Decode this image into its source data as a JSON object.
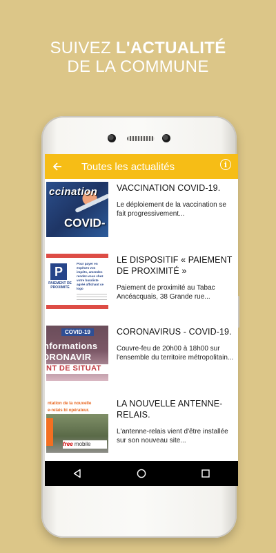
{
  "headline": {
    "line1_prefix": "SUIVEZ ",
    "line1_bold": "L'ACTUALITÉ",
    "line2": "DE LA COMMUNE"
  },
  "appbar": {
    "title": "Toutes les actualités",
    "back_icon": "arrow-left-icon",
    "info_icon": "info-icon",
    "color": "#f6bd16"
  },
  "news": [
    {
      "title": "VACCINATION COVID-19.",
      "description": "Le déploiement de la vaccination se fait progressivement...",
      "thumb_text": [
        "ccination",
        "COVID-"
      ]
    },
    {
      "title": "LE DISPOSITIF « PAIEMENT DE PROXIMITÉ »",
      "description": "Paiement de proximité au Tabac Ancéacquais, 38 Grande rue...",
      "thumb_text": [
        "P",
        "PAIEMENT DE PROXIMITÉ",
        "Pour payer en espèces vos impôts, amendes rendez-vous chez votre buraliste agréé affichant ce logo"
      ]
    },
    {
      "title": "CORONAVIRUS - COVID-19.",
      "description": "Couvre-feu de 20h00 à 18h00 sur l'ensemble du territoire métropolitain...",
      "thumb_text": [
        "COVID-19",
        "nformations",
        "ORONAVIR",
        "NT DE SITUAT"
      ]
    },
    {
      "title": "LA NOUVELLE ANTENNE-RELAIS.",
      "description": "L'antenne-relais vient d'être installée sur son nouveau site...",
      "thumb_text": [
        "ntation de la nouvelle",
        "e-relais bi opérateur.",
        "free",
        "mobile"
      ]
    }
  ],
  "navbar": {
    "back": "triangle-back-icon",
    "home": "circle-home-icon",
    "recents": "square-recents-icon"
  }
}
